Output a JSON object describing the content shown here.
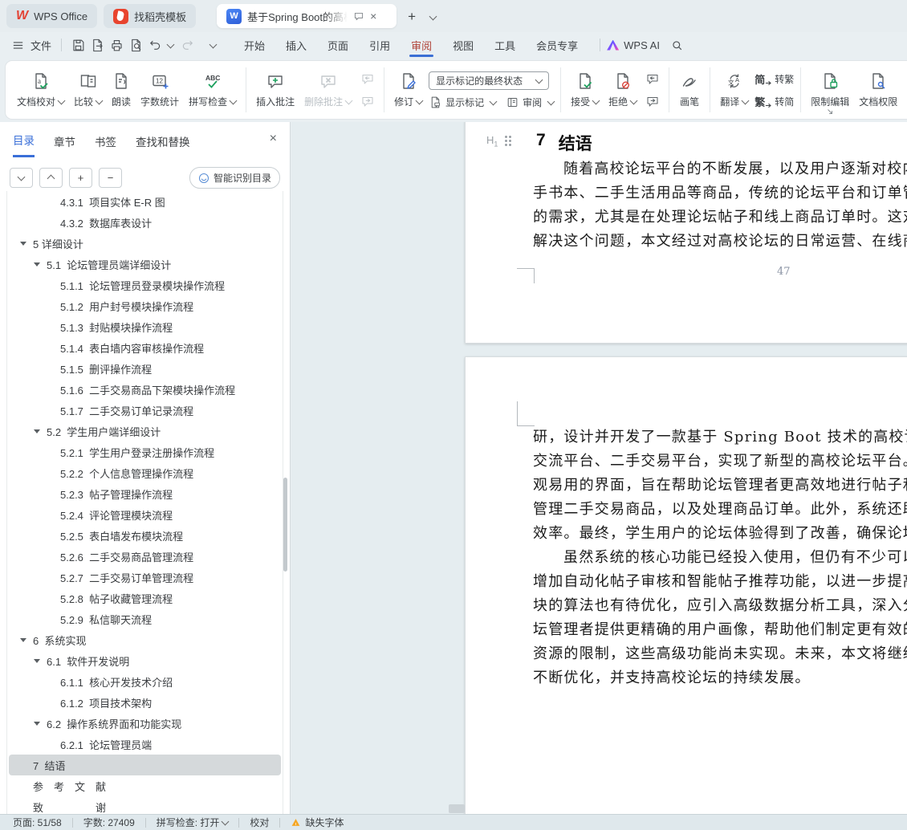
{
  "colors": {
    "accent_blue": "#3a6fd8",
    "wps_red": "#e34234",
    "active_menu_red": "#b0453a",
    "green": "#1ea15f",
    "reject_red": "#d8453c",
    "warning_yellow": "#f5a623"
  },
  "tabbar": {
    "app_tab": "WPS Office",
    "docer_tab": "找稻壳模板",
    "doc_tab": "基于Spring Boot的高校论坛交流"
  },
  "menubar": {
    "file": "文件",
    "wps_ai": "WPS AI",
    "items": [
      {
        "label": "开始"
      },
      {
        "label": "插入"
      },
      {
        "label": "页面"
      },
      {
        "label": "引用"
      },
      {
        "label": "审阅",
        "active": true
      },
      {
        "label": "视图"
      },
      {
        "label": "工具"
      },
      {
        "label": "会员专享"
      }
    ]
  },
  "ribbon": {
    "proof": "文档校对",
    "compare": "比较",
    "read_aloud": "朗读",
    "word_count": "字数统计",
    "spell_check": "拼写检查",
    "insert_comment": "插入批注",
    "delete_comment": "删除批注",
    "track_changes": "修订",
    "markup_state": "显示标记的最终状态",
    "show_markup": "显示标记",
    "review_pane": "审阅",
    "accept": "接受",
    "reject": "拒绝",
    "pen": "画笔",
    "translate": "翻译",
    "to_traditional": "转繁",
    "to_simplified": "转简",
    "to_traditional_glyph": "简",
    "to_simplified_glyph": "繁",
    "restrict_edit": "限制编辑",
    "doc_permission": "文档权限"
  },
  "sidebar": {
    "tabs": [
      {
        "label": "目录",
        "active": true
      },
      {
        "label": "章节"
      },
      {
        "label": "书签"
      },
      {
        "label": "查找和替换"
      }
    ],
    "tool_down": "",
    "tool_up": "",
    "tool_plus": "+",
    "tool_minus": "−",
    "smart_toc": "智能识别目录",
    "toc": [
      {
        "level": 3,
        "text": "4.3.1  项目实体 E-R 图"
      },
      {
        "level": 3,
        "text": "4.3.2  数据库表设计"
      },
      {
        "level": 1,
        "arrow": true,
        "text": "5 详细设计"
      },
      {
        "level": 2,
        "arrow": true,
        "text": "5.1  论坛管理员端详细设计"
      },
      {
        "level": 3,
        "text": "5.1.1  论坛管理员登录模块操作流程"
      },
      {
        "level": 3,
        "text": "5.1.2  用户封号模块操作流程"
      },
      {
        "level": 3,
        "text": "5.1.3  封贴模块操作流程"
      },
      {
        "level": 3,
        "text": "5.1.4  表白墙内容审核操作流程"
      },
      {
        "level": 3,
        "text": "5.1.5  删评操作流程"
      },
      {
        "level": 3,
        "text": "5.1.6  二手交易商品下架模块操作流程"
      },
      {
        "level": 3,
        "text": "5.1.7  二手交易订单记录流程"
      },
      {
        "level": 2,
        "arrow": true,
        "text": "5.2  学生用户端详细设计"
      },
      {
        "level": 3,
        "text": "5.2.1  学生用户登录注册操作流程"
      },
      {
        "level": 3,
        "text": "5.2.2  个人信息管理操作流程"
      },
      {
        "level": 3,
        "text": "5.2.3  帖子管理操作流程"
      },
      {
        "level": 3,
        "text": "5.2.4  评论管理模块流程"
      },
      {
        "level": 3,
        "text": "5.2.5  表白墙发布模块流程"
      },
      {
        "level": 3,
        "text": "5.2.6  二手交易商品管理流程"
      },
      {
        "level": 3,
        "text": "5.2.7  二手交易订单管理流程"
      },
      {
        "level": 3,
        "text": "5.2.8  帖子收藏管理流程"
      },
      {
        "level": 3,
        "text": "5.2.9  私信聊天流程"
      },
      {
        "level": 1,
        "arrow": true,
        "text": "6  系统实现"
      },
      {
        "level": 2,
        "arrow": true,
        "text": "6.1  软件开发说明"
      },
      {
        "level": 3,
        "text": "6.1.1  核心开发技术介绍"
      },
      {
        "level": 3,
        "text": "6.1.2  项目技术架构"
      },
      {
        "level": 2,
        "arrow": true,
        "text": "6.2  操作系统界面和功能实现"
      },
      {
        "level": 3,
        "text": "6.2.1  论坛管理员端"
      },
      {
        "level": 1,
        "selected": true,
        "text": "7  结语"
      },
      {
        "level": 1,
        "text": "参　考　文　献"
      },
      {
        "level": 1,
        "text": "致　　　　　谢"
      }
    ]
  },
  "document": {
    "h1_marker_h": "H",
    "h1_marker_sub": "1",
    "heading_number": "7",
    "heading_text": "结语",
    "page1_lines": [
      {
        "indent": true,
        "text": "随着高校论坛平台的不断发展，以及用户逐渐对校内二手商品"
      },
      {
        "text": "手书本、二手生活用品等商品，传统的论坛平台和订单管理方式已"
      },
      {
        "text": "的需求，尤其是在处理论坛帖子和线上商品订单时。这对运营效率"
      },
      {
        "text": "解决这个问题，本文经过对高校论坛的日常运营、在线商品、订单"
      }
    ],
    "page1_number": "47",
    "page2_lines": [
      {
        "text": "研，设计并开发了一款基于 Spring Boot 技术的高校论坛交流系统"
      },
      {
        "text": "交流平台、二手交易平台，实现了新型的高校论坛平台。该系统具"
      },
      {
        "text": "观易用的界面，旨在帮助论坛管理者更高效地进行帖子和评论的管"
      },
      {
        "text": "管理二手交易商品，以及处理商品订单。此外，系统还助力管理员"
      },
      {
        "text": "效率。最终，学生用户的论坛体验得到了改善，确保论坛成为一个"
      },
      {
        "indent": true,
        "text": "虽然系统的核心功能已经投入使用，但仍有不少可以改进的空"
      },
      {
        "text": "增加自动化帖子审核和智能帖子推荐功能，以进一步提高运营效率"
      },
      {
        "text": "块的算法也有待优化，应引入高级数据分析工具，深入分析用户行"
      },
      {
        "text": "坛管理者提供更精确的用户画像，帮助他们制定更有效的运营策略"
      },
      {
        "text": "资源的限制，这些高级功能尚未实现。未来，本文将继续研发这些"
      },
      {
        "text": "不断优化，并支持高校论坛的持续发展。"
      }
    ]
  },
  "statusbar": {
    "page_info": "页面: 51/58",
    "word_count": "字数: 27409",
    "spell_check": "拼写检查: 打开",
    "proofread": "校对",
    "missing_font": "缺失字体"
  }
}
